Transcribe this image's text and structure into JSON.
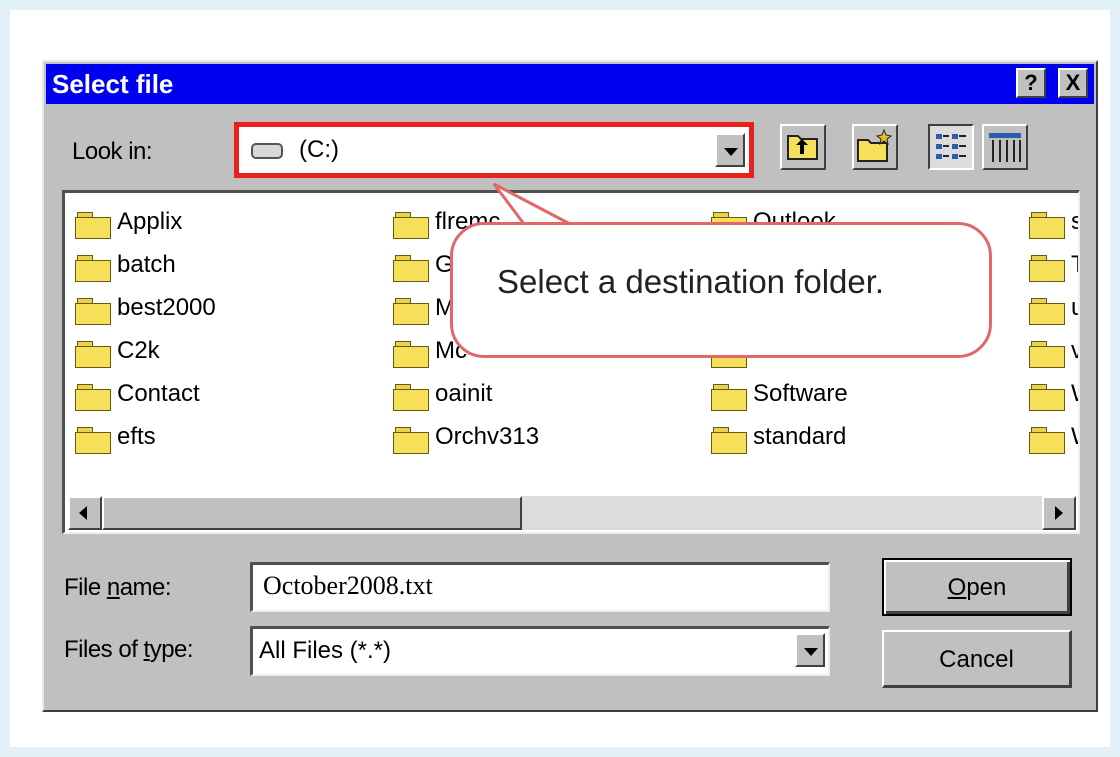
{
  "dialog": {
    "title": "Select file",
    "help_label": "?",
    "close_label": "X"
  },
  "lookin": {
    "label": "Look in:",
    "value": "(C:)"
  },
  "files": {
    "columns": [
      [
        "Applix",
        "batch",
        "best2000",
        "C2k",
        "Contact",
        "efts"
      ],
      [
        "flremc",
        "Ge",
        "M",
        "Mc",
        "oainit",
        "Orchv313"
      ],
      [
        "Outlook",
        "",
        "",
        "",
        "Software",
        "standard"
      ],
      [
        "st",
        "T",
        "ur",
        "vi",
        "W",
        "W"
      ]
    ]
  },
  "filename": {
    "label": "File name:",
    "value": "October2008.txt"
  },
  "filetype": {
    "label": "Files of type:",
    "value": "All Files (*.*)"
  },
  "buttons": {
    "open": "Open",
    "cancel": "Cancel"
  },
  "callout": {
    "text": "Select a destination folder."
  },
  "colors": {
    "titlebar": "#0000f0",
    "highlight": "#e8211f",
    "callout_border": "#e06868"
  }
}
